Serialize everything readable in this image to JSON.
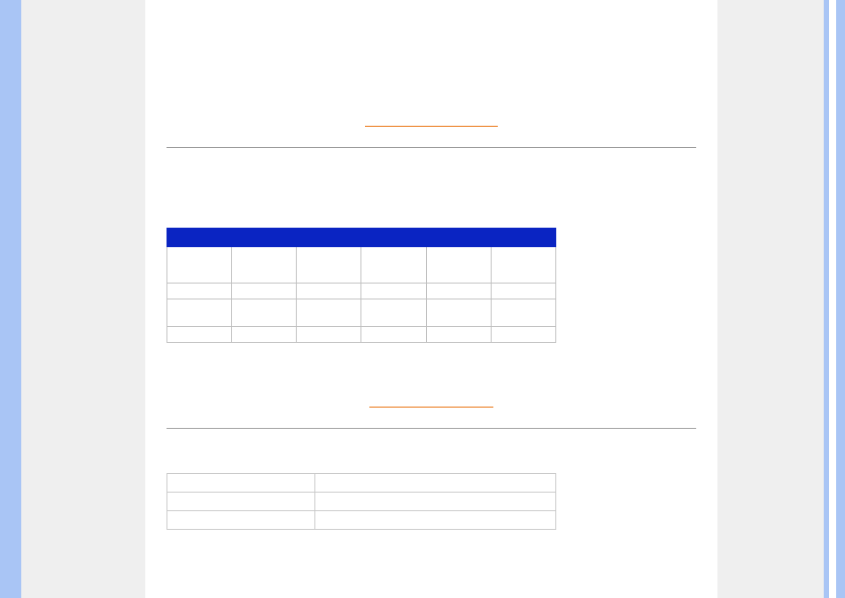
{
  "section1": {
    "link_label": " ",
    "table": {
      "rows": [
        [
          "",
          "",
          "",
          "",
          "",
          ""
        ],
        [
          "",
          "",
          "",
          "",
          "",
          ""
        ],
        [
          "",
          "",
          "",
          "",
          "",
          ""
        ],
        [
          "",
          "",
          "",
          "",
          "",
          ""
        ],
        [
          "",
          "",
          "",
          "",
          "",
          ""
        ]
      ]
    }
  },
  "section2": {
    "link_label": " ",
    "table": {
      "rows": [
        [
          "",
          ""
        ],
        [
          "",
          ""
        ],
        [
          "",
          ""
        ]
      ]
    }
  }
}
